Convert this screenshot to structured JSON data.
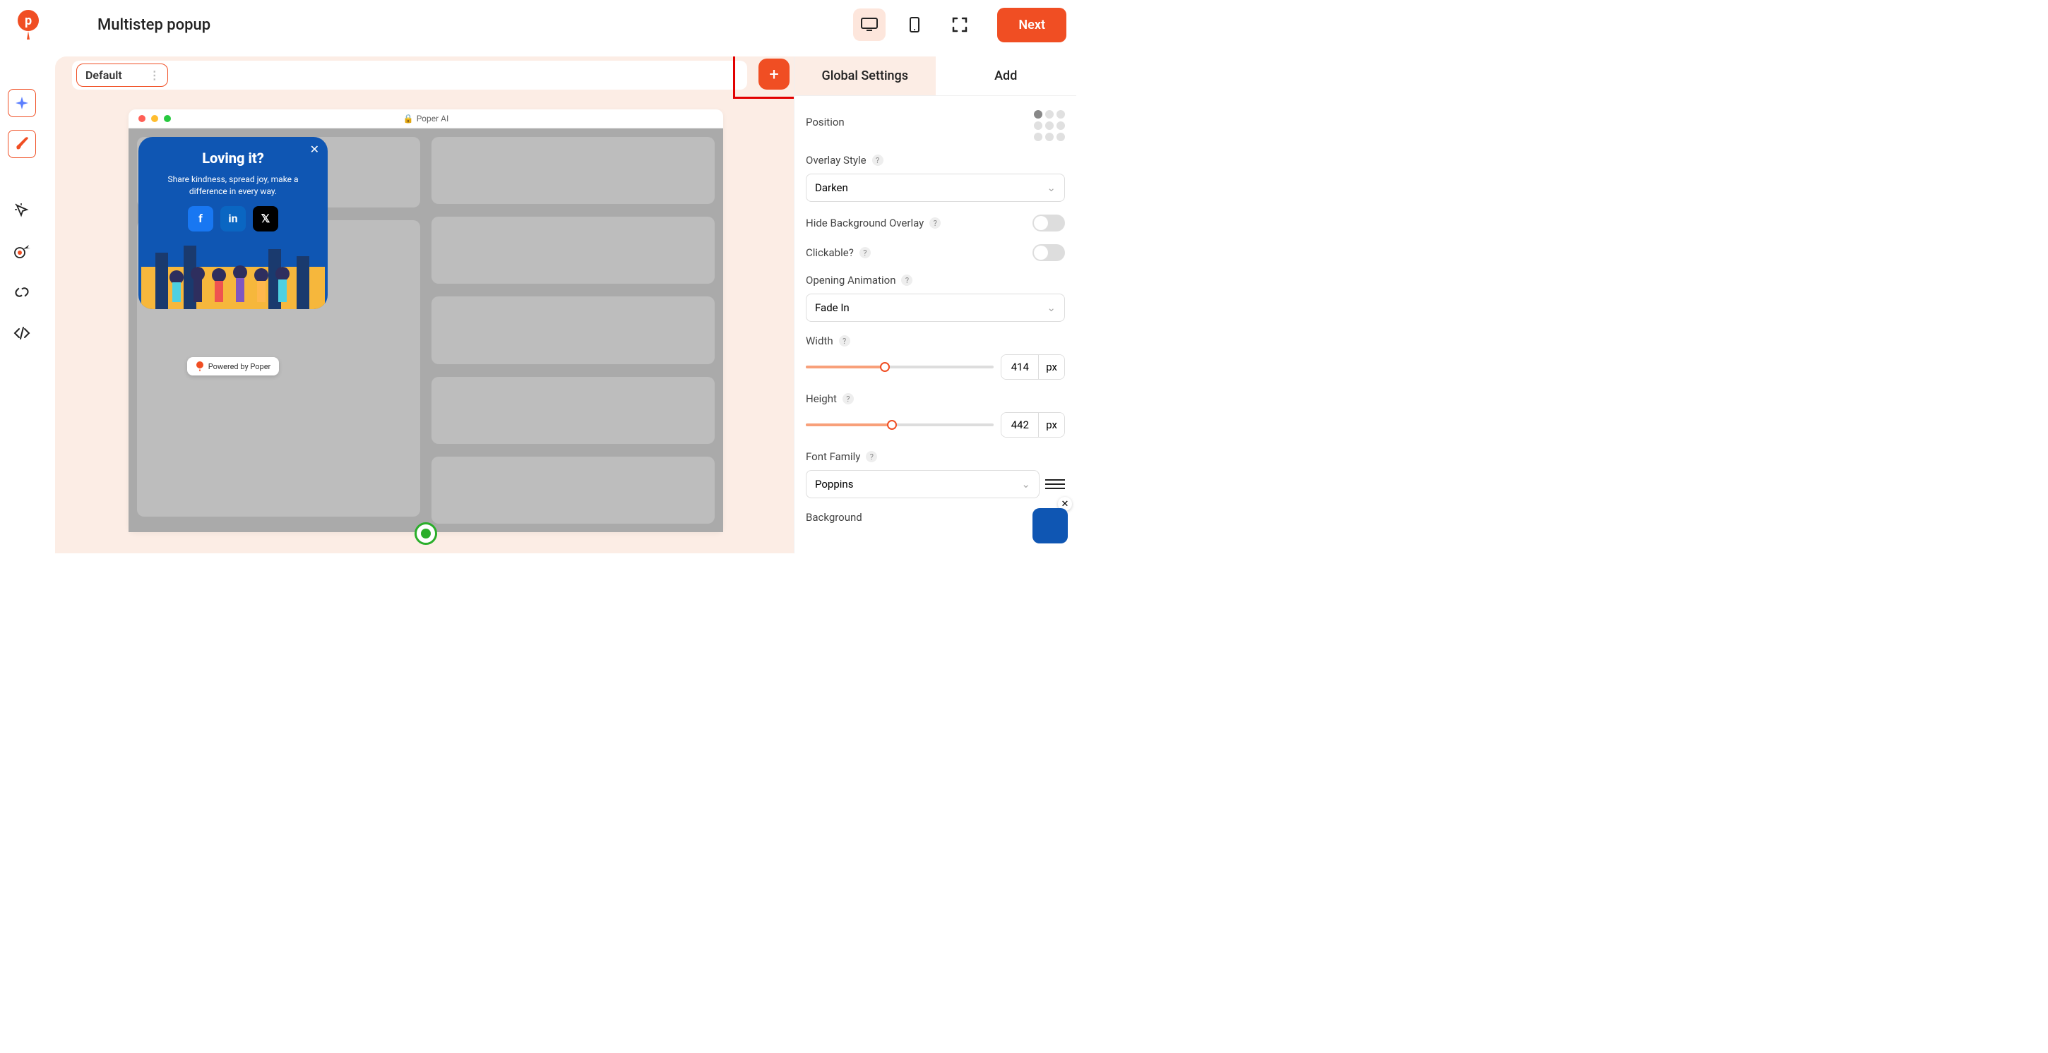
{
  "header": {
    "title": "Multistep popup",
    "next_label": "Next"
  },
  "step_chip": {
    "label": "Default"
  },
  "add_step": {
    "icon": "plus"
  },
  "browser": {
    "title": "Poper AI",
    "lock_icon": "lock"
  },
  "popup": {
    "title": "Loving it?",
    "subtitle": "Share kindness, spread joy, make a difference in every way.",
    "socials": [
      "facebook",
      "linkedin",
      "x"
    ],
    "powered": "Powered by Poper"
  },
  "panel": {
    "tabs": {
      "global": "Global Settings",
      "add": "Add"
    },
    "position_label": "Position",
    "overlay_style": {
      "label": "Overlay Style",
      "value": "Darken"
    },
    "hide_overlay": {
      "label": "Hide Background Overlay",
      "value": false
    },
    "clickable": {
      "label": "Clickable?",
      "value": false
    },
    "opening_anim": {
      "label": "Opening Animation",
      "value": "Fade In"
    },
    "width": {
      "label": "Width",
      "value": "414",
      "unit": "px",
      "pct": 42
    },
    "height": {
      "label": "Height",
      "value": "442",
      "unit": "px",
      "pct": 46
    },
    "font_family": {
      "label": "Font Family",
      "value": "Poppins"
    },
    "background": {
      "label": "Background"
    }
  },
  "help_char": "?"
}
